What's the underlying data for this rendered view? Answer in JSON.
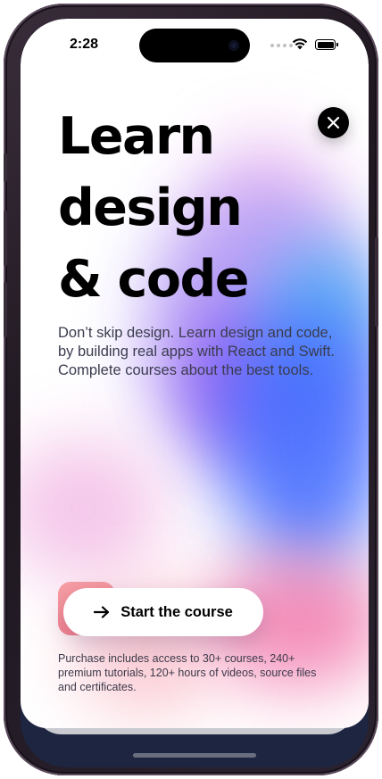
{
  "status_bar": {
    "time": "2:28"
  },
  "headline": {
    "lines": [
      "Learn",
      "design",
      "& code"
    ]
  },
  "description": "Don’t skip design. Learn design and code, by building real apps with React and Swift. Complete courses about the best tools.",
  "cta": {
    "label": "Start the course",
    "icon": "arrow-right-icon"
  },
  "fineprint": "Purchase includes access to 30+ courses, 240+ premium tutorials, 120+ hours of videos, source files and certificates.",
  "close_button": {
    "icon": "close-icon"
  },
  "colors": {
    "background": "#ffffff",
    "text_primary": "#000000",
    "text_secondary": "#3a3c4e",
    "accent_pink": "#f47a8a",
    "accent_purple": "#7d3cf2",
    "accent_blue": "#3f6bff"
  }
}
